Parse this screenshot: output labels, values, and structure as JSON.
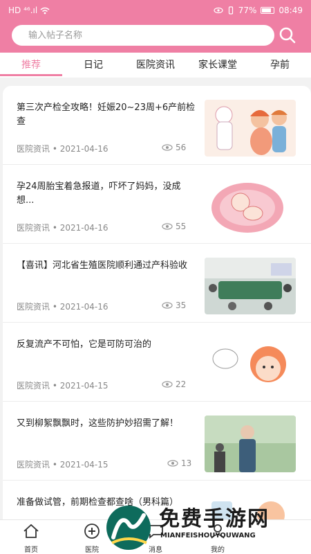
{
  "status_bar": {
    "left": "HD ⁴⁶.ıl",
    "battery": "77%",
    "time": "08:49"
  },
  "search": {
    "placeholder": "输入帖子名称"
  },
  "tabs": [
    {
      "label": "推荐",
      "active": true
    },
    {
      "label": "日记",
      "active": false
    },
    {
      "label": "医院资讯",
      "active": false
    },
    {
      "label": "家长课堂",
      "active": false
    },
    {
      "label": "孕前",
      "active": false
    }
  ],
  "articles": [
    {
      "title": "第三次产检全攻略！妊娠20~23周+6产前检查",
      "category": "医院资讯",
      "date": "2021-04-16",
      "views": "56"
    },
    {
      "title": "孕24周胎宝着急报道，吓坏了妈妈，没成想...",
      "category": "医院资讯",
      "date": "2021-04-16",
      "views": "55"
    },
    {
      "title": "【喜讯】河北省生殖医院顺利通过产科验收",
      "category": "医院资讯",
      "date": "2021-04-16",
      "views": "35"
    },
    {
      "title": "反复流产不可怕，它是可防可治的",
      "category": "医院资讯",
      "date": "2021-04-15",
      "views": "22"
    },
    {
      "title": "又到柳絮飘飘时，这些防护妙招需了解！",
      "category": "医院资讯",
      "date": "2021-04-15",
      "views": "13"
    },
    {
      "title": "准备做试管，前期检查都查啥（男科篇）",
      "category": "",
      "date": "",
      "views": ""
    }
  ],
  "meta_sep": " • ",
  "bottom_nav": [
    {
      "label": "首页"
    },
    {
      "label": "医院"
    },
    {
      "label": "消息"
    },
    {
      "label": "我的"
    }
  ],
  "watermark": {
    "title": "免费手游网",
    "subtitle": "MIANFEISHOUYOUWANG"
  },
  "colors": {
    "brand": "#ef7fa4",
    "text": "#222222",
    "muted": "#888888"
  }
}
